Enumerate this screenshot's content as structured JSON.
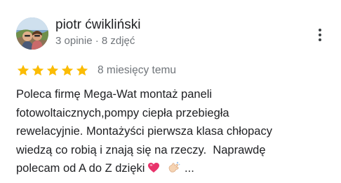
{
  "review": {
    "author": {
      "name": "piotr ćwikliński",
      "meta": "3 opinie · 8 zdjęć",
      "avatar_icon": "profile-photo"
    },
    "more_icon": "more-vert-icon",
    "rating": {
      "stars": 5,
      "max_stars": 5,
      "star_color": "#fbbc04"
    },
    "date": "8 miesięcy temu",
    "text_lines": [
      "Poleca firmę Mega-Wat montaż paneli",
      "fotowoltaicznych,pompy ciepła przebiegła",
      "rewelacyjnie. Montażyści pierwsza klasa chłopacy",
      "wiedzą co robią i znają się na rzeczy.  Naprawdę",
      "polecam od A do Z dzięki"
    ],
    "emojis": [
      "heart-emoji",
      "hand-emoji"
    ],
    "ellipsis": "..."
  }
}
